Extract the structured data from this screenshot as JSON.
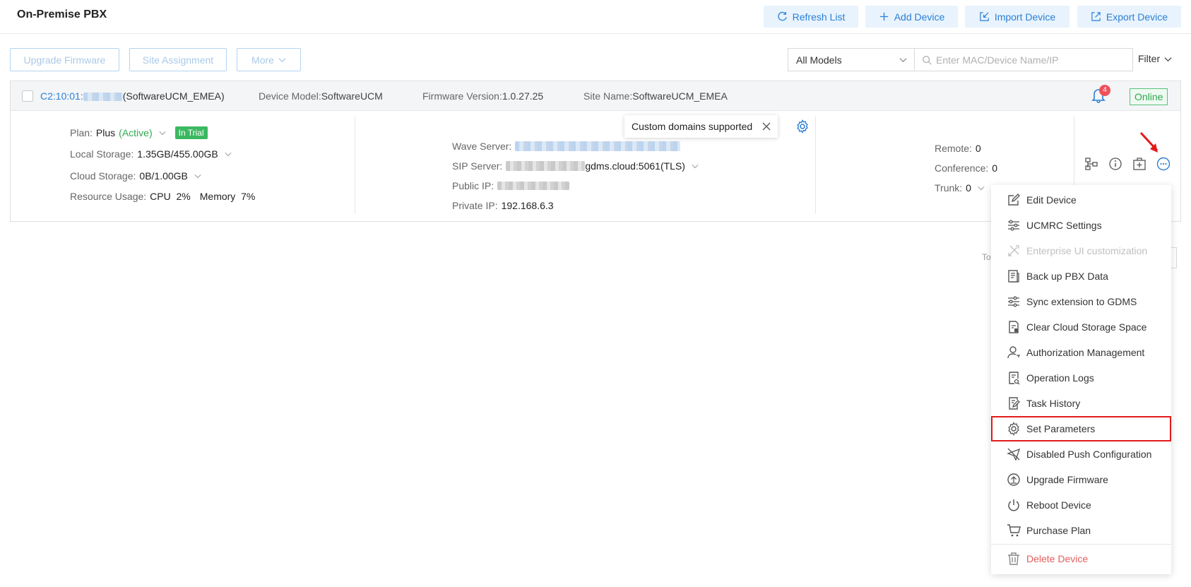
{
  "header": {
    "title": "On-Premise PBX",
    "buttons": {
      "refresh": "Refresh List",
      "add": "Add Device",
      "import": "Import Device",
      "export": "Export Device"
    }
  },
  "toolbar": {
    "upgrade_firmware": "Upgrade Firmware",
    "site_assignment": "Site Assignment",
    "more": "More",
    "model_select": "All Models",
    "search_placeholder": "Enter MAC/Device Name/IP",
    "filter": "Filter"
  },
  "device": {
    "mac_prefix": "C2:10:01:",
    "mac_suffix": "(SoftwareUCM_EMEA)",
    "model_label": "Device Model:",
    "model_value": "SoftwareUCM",
    "firmware_label": "Firmware Version:",
    "firmware_value": "1.0.27.25",
    "site_label": "Site Name:",
    "site_value": "SoftwareUCM_EMEA",
    "notification_count": "4",
    "status": "Online",
    "plan_label": "Plan:",
    "plan_value": "Plus",
    "plan_state": "(Active)",
    "trial_badge": "In Trial",
    "local_storage_label": "Local Storage:",
    "local_storage_value": "1.35GB/455.00GB",
    "cloud_storage_label": "Cloud Storage:",
    "cloud_storage_value": "0B/1.00GB",
    "resource_label": "Resource Usage:",
    "cpu": "CPU  2%",
    "memory": "Memory  7%",
    "wave_label": "Wave Server:",
    "sip_label": "SIP Server:",
    "sip_value": "gdms.cloud:5061(TLS)",
    "public_ip_label": "Public IP:",
    "private_ip_label": "Private IP:",
    "private_ip_value": "192.168.6.3",
    "remote_label": "Remote:",
    "remote_value": "0",
    "conference_label": "Conference:",
    "conference_value": "0",
    "trunk_label": "Trunk:",
    "trunk_value": "0"
  },
  "tooltip": {
    "text": "Custom domains supported"
  },
  "pagination": {
    "total_fragment": "To"
  },
  "menu": {
    "items": [
      {
        "label": "Edit Device",
        "icon": "edit-icon"
      },
      {
        "label": "UCMRC Settings",
        "icon": "sliders-icon"
      },
      {
        "label": "Enterprise UI customization",
        "icon": "tools-icon"
      },
      {
        "label": "Back up PBX Data",
        "icon": "backup-icon"
      },
      {
        "label": "Sync extension to GDMS",
        "icon": "sync-sliders-icon"
      },
      {
        "label": "Clear Cloud Storage Space",
        "icon": "clear-storage-icon"
      },
      {
        "label": "Authorization Management",
        "icon": "user-key-icon"
      },
      {
        "label": "Operation Logs",
        "icon": "logs-icon"
      },
      {
        "label": "Task History",
        "icon": "task-icon"
      },
      {
        "label": "Set Parameters",
        "icon": "gear-icon"
      },
      {
        "label": "Disabled Push Configuration",
        "icon": "push-disabled-icon"
      },
      {
        "label": "Upgrade Firmware",
        "icon": "upgrade-icon"
      },
      {
        "label": "Reboot Device",
        "icon": "power-icon"
      },
      {
        "label": "Purchase Plan",
        "icon": "cart-icon"
      },
      {
        "label": "Delete Device",
        "icon": "trash-icon"
      }
    ]
  },
  "colors": {
    "accent": "#2b7fd6",
    "success": "#2fa850",
    "danger": "#e35d5d",
    "highlight_box": "#e31a1a"
  }
}
